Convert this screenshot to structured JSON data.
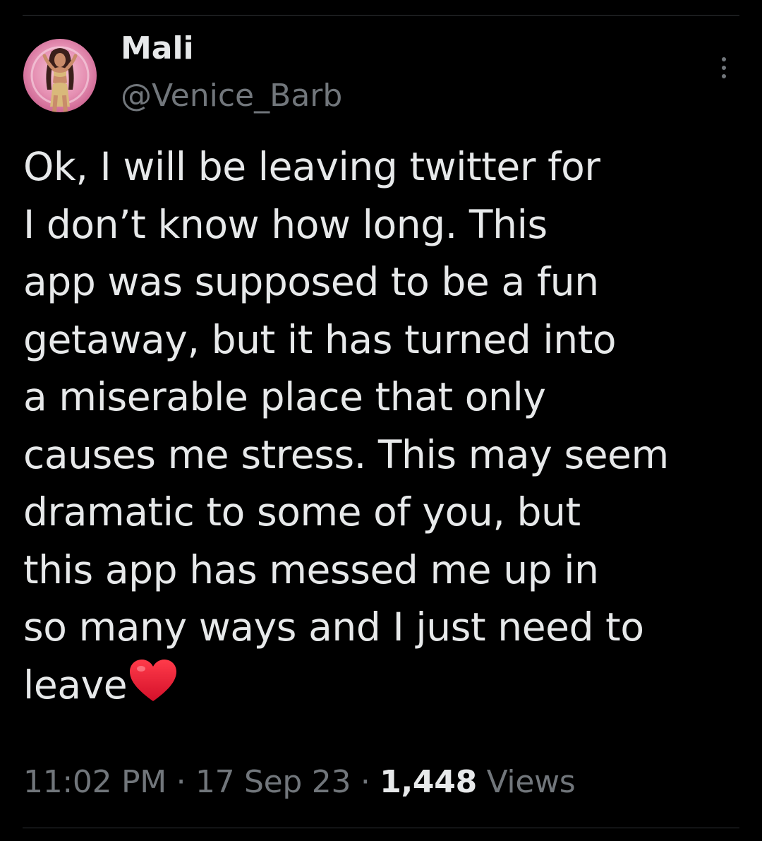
{
  "tweet": {
    "author": {
      "display_name": "Mali",
      "handle": "@Venice_Barb"
    },
    "text_lines": [
      "Ok, I will be leaving twitter for",
      "I don’t know how long. This",
      "app was supposed to be a fun",
      "getaway, but it has turned into",
      "a miserable place that only",
      "causes me stress. This may seem",
      "dramatic to some of you, but",
      "this app has messed me up in",
      "so many ways and I just need to",
      "leave"
    ],
    "emoji": "heart-emoji",
    "time": "11:02 PM",
    "separator": " · ",
    "date": "17 Sep 23",
    "views_count": "1,448",
    "views_label": " Views"
  },
  "icons": {
    "more": "more-vertical-icon"
  },
  "colors": {
    "background": "#000000",
    "text_primary": "#e7e9ea",
    "text_secondary": "#71767b",
    "divider": "#2f3336",
    "heart": "#e0245e"
  }
}
